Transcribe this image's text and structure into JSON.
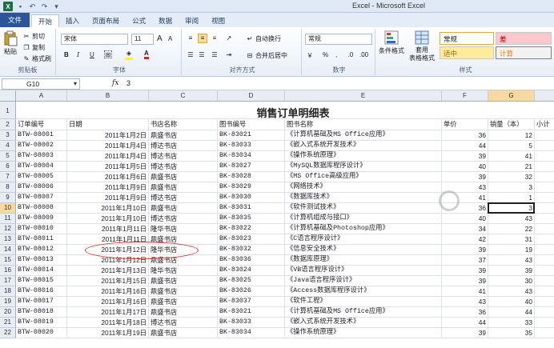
{
  "window": {
    "title": "Excel - Microsoft Excel"
  },
  "tabs": [
    "文件",
    "开始",
    "插入",
    "页面布局",
    "公式",
    "数据",
    "审阅",
    "视图"
  ],
  "ribbon": {
    "clipboard": {
      "paste": "粘贴",
      "cut": "剪切",
      "copy": "复制",
      "format_painter": "格式刷",
      "label": "剪贴板"
    },
    "font": {
      "name": "宋体",
      "size": "11",
      "grow": "A",
      "shrink": "A",
      "bold": "B",
      "italic": "I",
      "underline": "U",
      "fill_color": "A",
      "font_color": "A",
      "label": "字体"
    },
    "alignment": {
      "wrap": "自动换行",
      "merge": "合并后居中",
      "label": "对齐方式"
    },
    "number": {
      "format": "常规",
      "currency": "￥",
      "percent": "%",
      "comma": ",",
      "label": "数字"
    },
    "styles": {
      "conditional": "条件格式",
      "table": "套用\n表格格式",
      "normal": "常规",
      "bad": "差",
      "neutral": "适中",
      "calc": "计算",
      "label": "样式"
    }
  },
  "formula_bar": {
    "name_box": "G10",
    "fx": "fx",
    "value": "3"
  },
  "columns": [
    "A",
    "B",
    "C",
    "D",
    "E",
    "F",
    "G"
  ],
  "sheet": {
    "title": "销售订单明细表",
    "headers": [
      "订单编号",
      "日期",
      "书店名称",
      "图书编号",
      "图书名称",
      "单价",
      "销量（本）",
      "小计"
    ],
    "rows": [
      [
        "BTW-08001",
        "2011年1月2日",
        "鼎盛书店",
        "BK-83021",
        "《计算机基础及MS Office应用》",
        "36",
        "12"
      ],
      [
        "BTW-08002",
        "2011年1月4日",
        "博达书店",
        "BK-83033",
        "《嵌入式系统开发技术》",
        "44",
        "5"
      ],
      [
        "BTW-08003",
        "2011年1月4日",
        "博达书店",
        "BK-83034",
        "《操作系统原理》",
        "39",
        "41"
      ],
      [
        "BTW-08004",
        "2011年1月5日",
        "博达书店",
        "BK-83027",
        "《MySQL数据库程序设计》",
        "40",
        "21"
      ],
      [
        "BTW-08005",
        "2011年1月6日",
        "鼎盛书店",
        "BK-83028",
        "《MS Office高级应用》",
        "39",
        "32"
      ],
      [
        "BTW-08006",
        "2011年1月9日",
        "鼎盛书店",
        "BK-83029",
        "《网络技术》",
        "43",
        "3"
      ],
      [
        "BTW-08007",
        "2011年1月9日",
        "博达书店",
        "BK-83030",
        "《数据库技术》",
        "41",
        "1"
      ],
      [
        "BTW-08008",
        "2011年1月10日",
        "鼎盛书店",
        "BK-83031",
        "《软件测试技术》",
        "36",
        "3"
      ],
      [
        "BTW-08009",
        "2011年1月10日",
        "博达书店",
        "BK-83035",
        "《计算机组成与接口》",
        "40",
        "43"
      ],
      [
        "BTW-08010",
        "2011年1月11日",
        "隆华书店",
        "BK-83022",
        "《计算机基础及Photoshop应用》",
        "34",
        "22"
      ],
      [
        "BTW-08011",
        "2011年1月11日",
        "鼎盛书店",
        "BK-83023",
        "《C语言程序设计》",
        "42",
        "31"
      ],
      [
        "BTW-08012",
        "2011年1月12日",
        "隆华书店",
        "BK-83032",
        "《信息安全技术》",
        "39",
        "19"
      ],
      [
        "BTW-08013",
        "2011年1月12日",
        "鼎盛书店",
        "BK-83036",
        "《数据库原理》",
        "37",
        "43"
      ],
      [
        "BTW-08014",
        "2011年1月13日",
        "隆华书店",
        "BK-83024",
        "《VB语言程序设计》",
        "39",
        "39"
      ],
      [
        "BTW-08015",
        "2011年1月15日",
        "鼎盛书店",
        "BK-83025",
        "《Java语言程序设计》",
        "39",
        "30"
      ],
      [
        "BTW-08016",
        "2011年1月16日",
        "鼎盛书店",
        "BK-83026",
        "《Access数据库程序设计》",
        "41",
        "43"
      ],
      [
        "BTW-08017",
        "2011年1月16日",
        "鼎盛书店",
        "BK-83037",
        "《软件工程》",
        "43",
        "40"
      ],
      [
        "BTW-08018",
        "2011年1月17日",
        "鼎盛书店",
        "BK-83021",
        "《计算机基础及MS Office应用》",
        "36",
        "44"
      ],
      [
        "BTW-08019",
        "2011年1月18日",
        "博达书店",
        "BK-83033",
        "《嵌入式系统开发技术》",
        "44",
        "33"
      ],
      [
        "BTW-08020",
        "2011年1月19日",
        "鼎盛书店",
        "BK-83034",
        "《操作系统原理》",
        "39",
        "35"
      ]
    ]
  }
}
